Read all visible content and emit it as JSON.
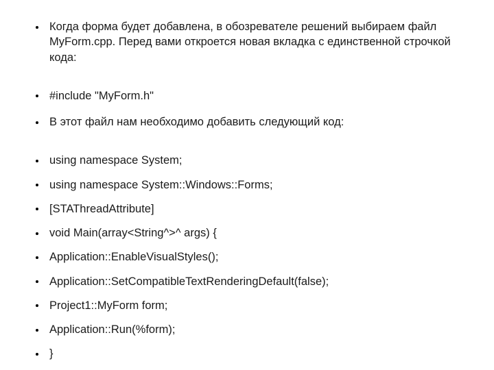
{
  "items": [
    "Когда форма будет добавлена, в обозревателе решений выбираем файл MyForm.cpp. Перед вами откроется новая вкладка с единственной строчкой кода:",
    "#include \"MyForm.h\"",
    "В этот файл нам необходимо добавить следующий код:",
    "using namespace System;",
    "using namespace System::Windows::Forms;",
    "[STAThreadAttribute]",
    "void Main(array<String^>^ args) {",
    "Application::EnableVisualStyles();",
    "Application::SetCompatibleTextRenderingDefault(false);",
    "Project1::MyForm form;",
    "Application::Run(%form);",
    "}"
  ]
}
